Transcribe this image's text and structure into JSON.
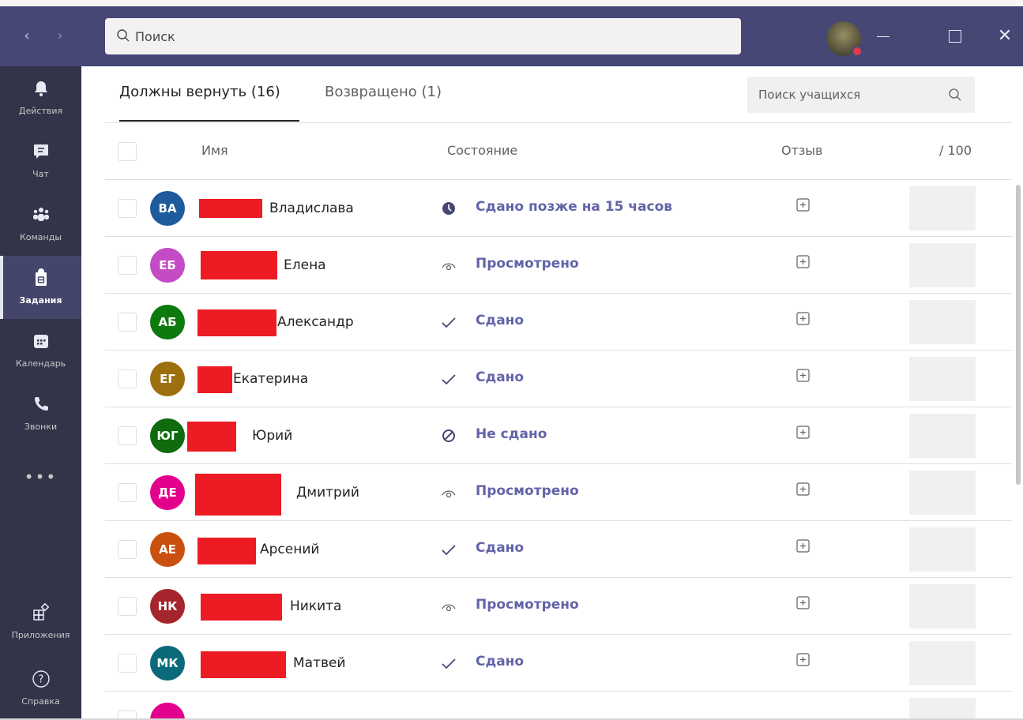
{
  "titlebar": {
    "search_placeholder": "Поиск"
  },
  "rail": {
    "items": [
      {
        "label": "Действия",
        "icon": "bell-icon"
      },
      {
        "label": "Чат",
        "icon": "chat-icon"
      },
      {
        "label": "Команды",
        "icon": "teams-icon"
      },
      {
        "label": "Задания",
        "icon": "assignments-icon",
        "active": true
      },
      {
        "label": "Календарь",
        "icon": "calendar-icon"
      },
      {
        "label": "Звонки",
        "icon": "phone-icon"
      },
      {
        "label": "Приложения",
        "icon": "apps-icon"
      },
      {
        "label": "Справка",
        "icon": "help-icon"
      }
    ],
    "more_label": "•••"
  },
  "tabs": {
    "to_return": "Должны вернуть (16)",
    "returned": "Возвращено (1)"
  },
  "student_search": {
    "placeholder": "Поиск учащихся"
  },
  "table": {
    "headers": {
      "name": "Имя",
      "status": "Состояние",
      "feedback": "Отзыв",
      "points": "/ 100"
    },
    "rows": [
      {
        "initials": "ВА",
        "avatar_color": "#1e5a9c",
        "name": "Владислава",
        "status": "Сдано позже на 15 часов",
        "status_icon": "clock-icon"
      },
      {
        "initials": "ЕБ",
        "avatar_color": "#c34bc4",
        "name": "Елена",
        "status": "Просмотрено",
        "status_icon": "eye-icon"
      },
      {
        "initials": "АБ",
        "avatar_color": "#0e7a0e",
        "name": "Александр",
        "status": "Сдано",
        "status_icon": "check-icon"
      },
      {
        "initials": "ЕГ",
        "avatar_color": "#9c6f0f",
        "name": "Екатерина",
        "status": "Сдано",
        "status_icon": "check-icon"
      },
      {
        "initials": "ЮГ",
        "avatar_color": "#0e6b0e",
        "name": "Юрий",
        "status": "Не сдано",
        "status_icon": "blocked-icon"
      },
      {
        "initials": "ДЕ",
        "avatar_color": "#e3008c",
        "name": "Дмитрий",
        "status": "Просмотрено",
        "status_icon": "eye-icon"
      },
      {
        "initials": "АЕ",
        "avatar_color": "#ca5010",
        "name": "Арсений",
        "status": "Сдано",
        "status_icon": "check-icon"
      },
      {
        "initials": "НК",
        "avatar_color": "#a4262c",
        "name": "Никита",
        "status": "Просмотрено",
        "status_icon": "eye-icon"
      },
      {
        "initials": "МК",
        "avatar_color": "#0b6a7a",
        "name": "Матвей",
        "status": "Сдано",
        "status_icon": "check-icon"
      }
    ]
  }
}
